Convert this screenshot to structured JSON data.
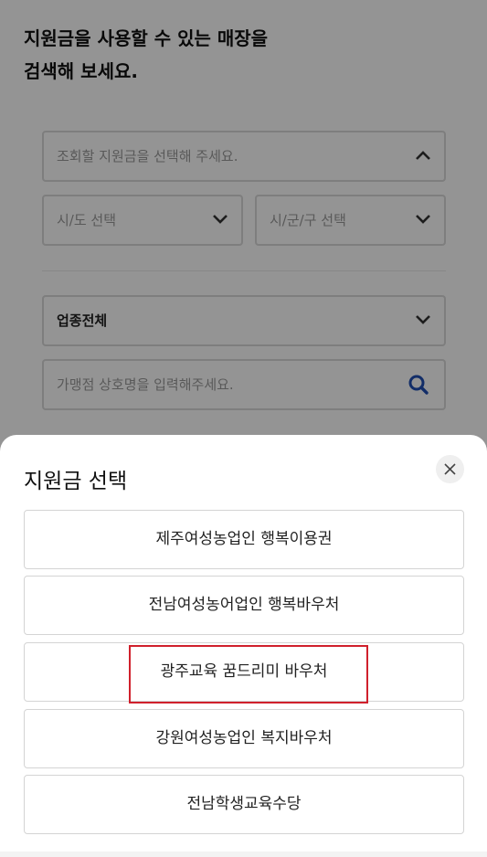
{
  "page": {
    "title": "지원금을 사용할 수 있는 매장을\n검색해 보세요.",
    "voucher_select": {
      "placeholder": "조회할 지원금을 선택해 주세요."
    },
    "region": {
      "province_placeholder": "시/도 선택",
      "city_placeholder": "시/군/구 선택"
    },
    "category": {
      "value": "업종전체"
    },
    "store_search": {
      "placeholder": "가맹점 상호명을 입력해주세요."
    }
  },
  "sheet": {
    "title": "지원금 선택",
    "options": [
      {
        "label": "제주여성농업인 행복이용권"
      },
      {
        "label": "전남여성농어업인 행복바우처"
      },
      {
        "label": "광주교육 꿈드리미 바우처"
      },
      {
        "label": "강원여성농업인 복지바우처"
      },
      {
        "label": "전남학생교육수당"
      }
    ],
    "highlighted_option": "광주교육 꿈드리미 바우처"
  },
  "colors": {
    "accent_search": "#1f4fb3",
    "highlight_box": "#d0202c"
  },
  "icons": [
    "chevron-up-icon",
    "chevron-down-icon",
    "search-icon",
    "close-icon"
  ]
}
